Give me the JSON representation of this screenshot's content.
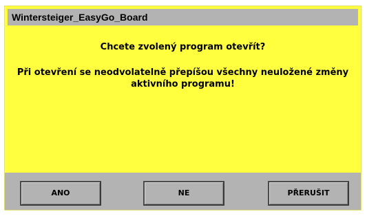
{
  "dialog": {
    "title": "Wintersteiger_EasyGo_Board",
    "question": "Chcete zvolený program otevřít?",
    "warning": "Při otevření se neodvolatelně přepíšou všechny neuložené změny aktivního programu!"
  },
  "buttons": {
    "yes_label": "ANO",
    "no_label": "NE",
    "cancel_label": "PŘERUŠIT"
  },
  "colors": {
    "dialog_background": "#ffff40",
    "title_bar": "#b3b3b3",
    "button_bar": "#b3b3b3"
  }
}
